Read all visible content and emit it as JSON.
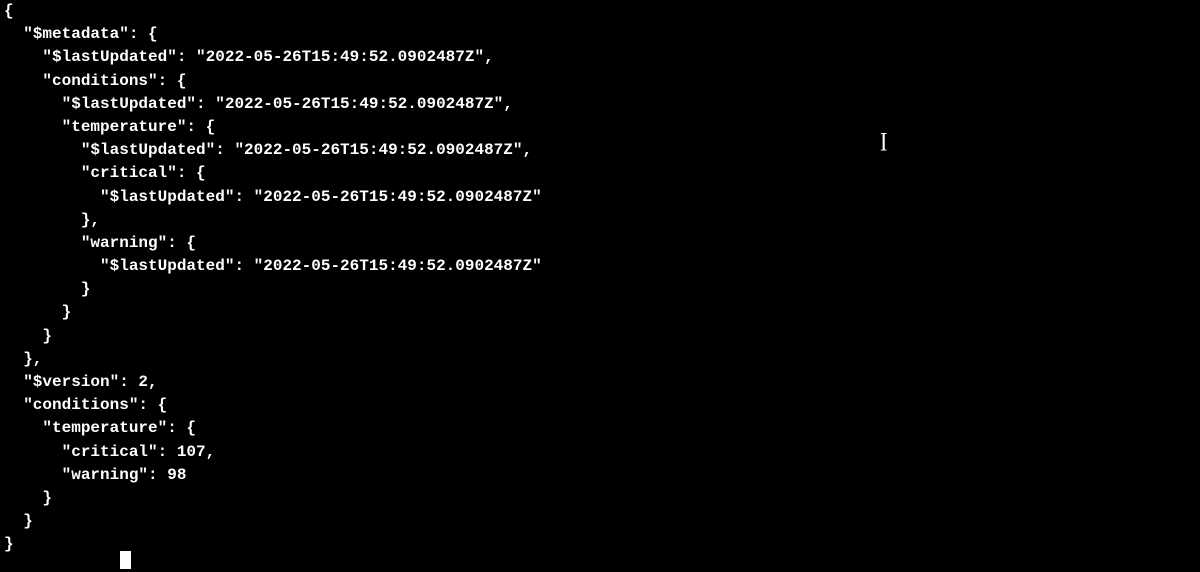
{
  "code": {
    "l1": "{",
    "l2": "  \"$metadata\": {",
    "l3": "    \"$lastUpdated\": \"2022-05-26T15:49:52.0902487Z\",",
    "l4": "    \"conditions\": {",
    "l5": "      \"$lastUpdated\": \"2022-05-26T15:49:52.0902487Z\",",
    "l6": "      \"temperature\": {",
    "l7": "        \"$lastUpdated\": \"2022-05-26T15:49:52.0902487Z\",",
    "l8": "        \"critical\": {",
    "l9": "          \"$lastUpdated\": \"2022-05-26T15:49:52.0902487Z\"",
    "l10": "        },",
    "l11": "        \"warning\": {",
    "l12": "          \"$lastUpdated\": \"2022-05-26T15:49:52.0902487Z\"",
    "l13": "        }",
    "l14": "      }",
    "l15": "    }",
    "l16": "  },",
    "l17": "  \"$version\": 2,",
    "l18": "  \"conditions\": {",
    "l19": "    \"temperature\": {",
    "l20": "      \"critical\": 107,",
    "l21": "      \"warning\": 98",
    "l22": "    }",
    "l23": "  }",
    "l24": "}"
  },
  "caret": "I"
}
